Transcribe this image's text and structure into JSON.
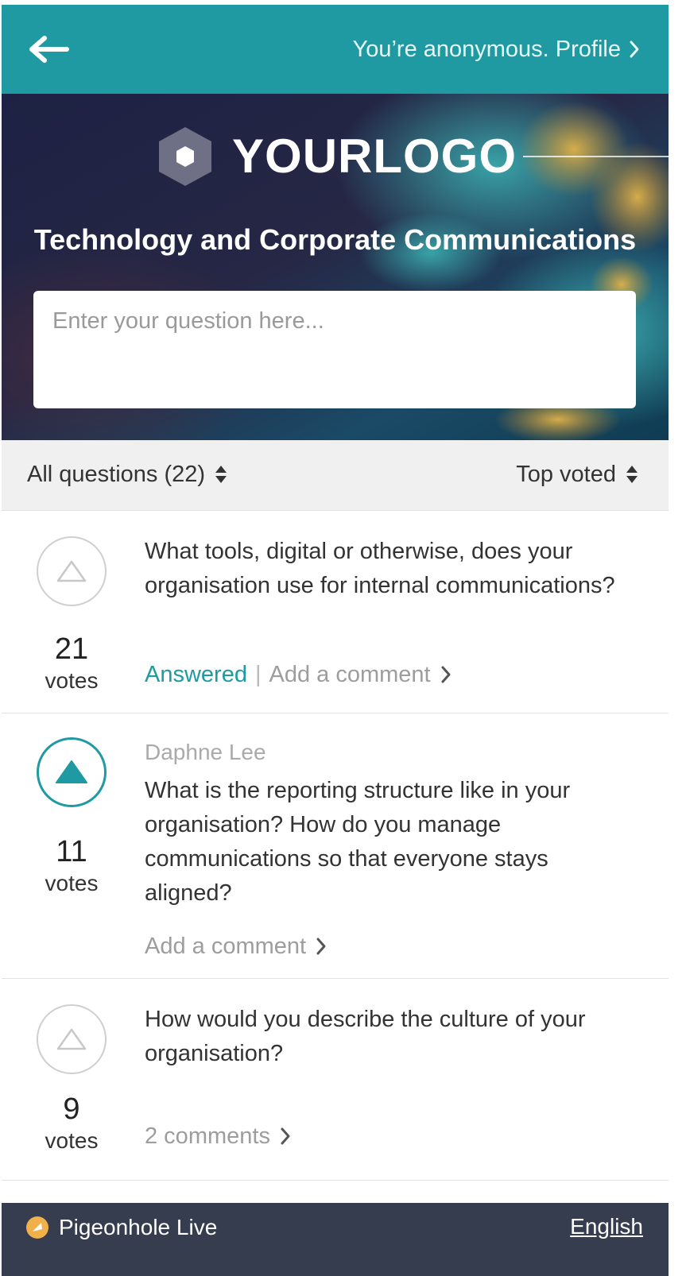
{
  "header": {
    "back_icon": "arrow-left-icon",
    "profile_text": "You’re anonymous. Profile"
  },
  "hero": {
    "logo_text": "YOURLOGO",
    "title": "Technology and Corporate Communications",
    "question_placeholder": "Enter your question here..."
  },
  "filters": {
    "left_label": "All questions (22)",
    "right_label": "Top voted"
  },
  "questions": [
    {
      "author": "",
      "text": "What tools, digital or otherwise, does your organisation use for internal communications?",
      "votes": "21",
      "votes_label": "votes",
      "voted": false,
      "status": "Answered",
      "separator": "|",
      "comment_label": "Add a comment"
    },
    {
      "author": "Daphne Lee",
      "text": "What is the reporting structure like in your organisation? How do you manage communications so that everyone stays aligned?",
      "votes": "11",
      "votes_label": "votes",
      "voted": true,
      "comment_label": "Add a comment"
    },
    {
      "author": "",
      "text": "How would you describe the culture of your organisation?",
      "votes": "9",
      "votes_label": "votes",
      "voted": false,
      "comment_label": "2 comments"
    }
  ],
  "footer": {
    "brand": "Pigeonhole Live",
    "language": "English"
  },
  "colors": {
    "accent": "#1f9aa2",
    "footer_bg": "#363d4f",
    "filter_bg": "#f0f0f1"
  }
}
